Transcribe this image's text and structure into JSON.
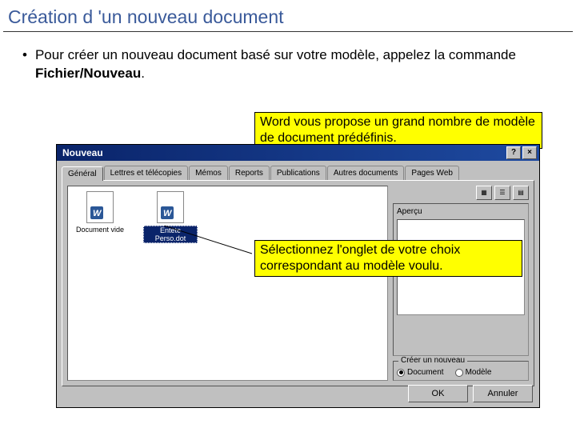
{
  "slide": {
    "title": "Création d 'un nouveau document",
    "bullet_prefix": "Pour créer un nouveau document basé sur votre modèle, appelez la commande ",
    "bullet_bold": "Fichier/Nouveau",
    "bullet_suffix": "."
  },
  "callouts": {
    "top": "Word vous propose un grand nombre de modèle de document prédéfinis.",
    "bottom": "Sélectionnez l'onglet de votre choix correspondant au modèle voulu."
  },
  "dialog": {
    "title": "Nouveau",
    "help_btn": "?",
    "close_btn": "×",
    "tabs": [
      "Général",
      "Lettres et télécopies",
      "Mémos",
      "Reports",
      "Publications",
      "Autres documents",
      "Pages Web"
    ],
    "items": [
      {
        "label": "Document vide",
        "selected": false
      },
      {
        "label": "Entete Perso.dot",
        "selected": true
      }
    ],
    "preview_label": "Aperçu",
    "create_label": "Créer un nouveau",
    "radios": [
      {
        "label": "Document",
        "checked": true
      },
      {
        "label": "Modèle",
        "checked": false
      }
    ],
    "ok": "OK",
    "cancel": "Annuler"
  }
}
